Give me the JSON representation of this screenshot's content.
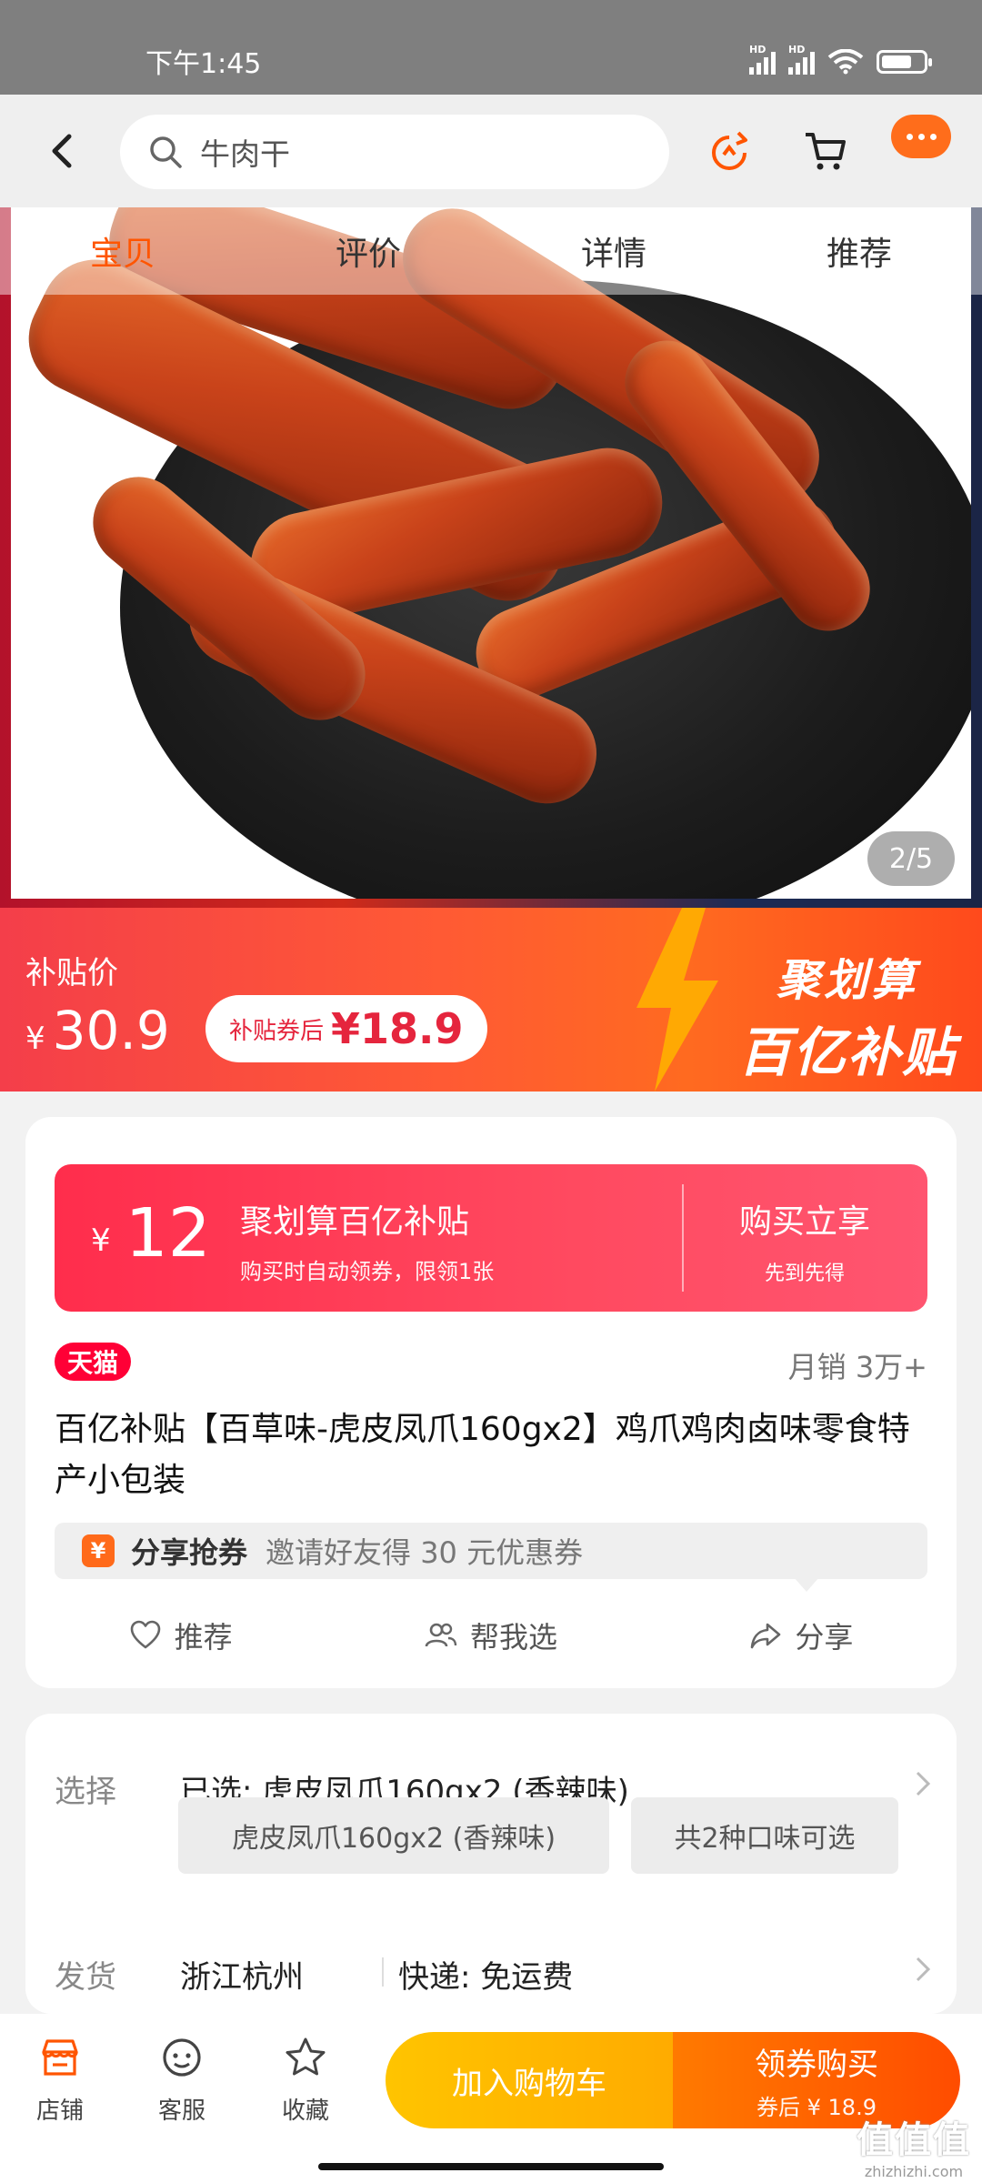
{
  "status_bar": {
    "time": "下午1:45",
    "signal1": "HD",
    "signal2": "HD"
  },
  "header": {
    "search_placeholder": "牛肉干"
  },
  "hero": {
    "tabs": [
      {
        "label": "宝贝"
      },
      {
        "label": "评价"
      },
      {
        "label": "详情"
      },
      {
        "label": "推荐"
      }
    ],
    "pager": "2/5"
  },
  "price": {
    "label": "补贴价",
    "currency": "¥",
    "amount": "30.9",
    "coupon_prefix": "补贴券后",
    "coupon_price": "¥18.9",
    "brand_line1": "聚划算",
    "brand_line2": "百亿补贴"
  },
  "promo": {
    "currency": "¥",
    "amount": "12",
    "title": "聚划算百亿补贴",
    "subtitle": "购买时自动领券，限领1张",
    "cta": "购买立享",
    "cta_sub": "先到先得"
  },
  "product": {
    "store_badge": "天猫",
    "sales": "月销 3万+",
    "title": "百亿补贴【百草味-虎皮凤爪160gx2】鸡爪鸡肉卤味零食特产小包装",
    "share_label": "分享抢券",
    "share_desc": "邀请好友得 30 元优惠券",
    "actions": [
      {
        "label": "推荐",
        "icon": "heart-icon"
      },
      {
        "label": "帮我选",
        "icon": "people-icon"
      },
      {
        "label": "分享",
        "icon": "share-icon"
      }
    ]
  },
  "spec": {
    "select_label": "选择",
    "select_value": "已选: 虎皮凤爪160gx2 (香辣味)",
    "options": [
      "虎皮凤爪160gx2 (香辣味)",
      "共2种口味可选"
    ],
    "ship_label": "发货",
    "ship_from": "浙江杭州",
    "ship_method": "快递: 免运费"
  },
  "bottom": {
    "nav": [
      {
        "label": "店铺",
        "icon": "store-icon"
      },
      {
        "label": "客服",
        "icon": "service-icon"
      },
      {
        "label": "收藏",
        "icon": "star-icon"
      }
    ],
    "cart_label": "加入购物车",
    "buy_label": "领券购买",
    "buy_sub": "券后 ¥ 18.9"
  },
  "watermark": {
    "line1": "值值值",
    "line2": "zhizhizhi.com"
  },
  "colors": {
    "accent": "#ff5500",
    "tmall": "#ff0036",
    "promo": "#ff2d4c",
    "cart": "#ffc400",
    "buy": "#ff5a00"
  }
}
